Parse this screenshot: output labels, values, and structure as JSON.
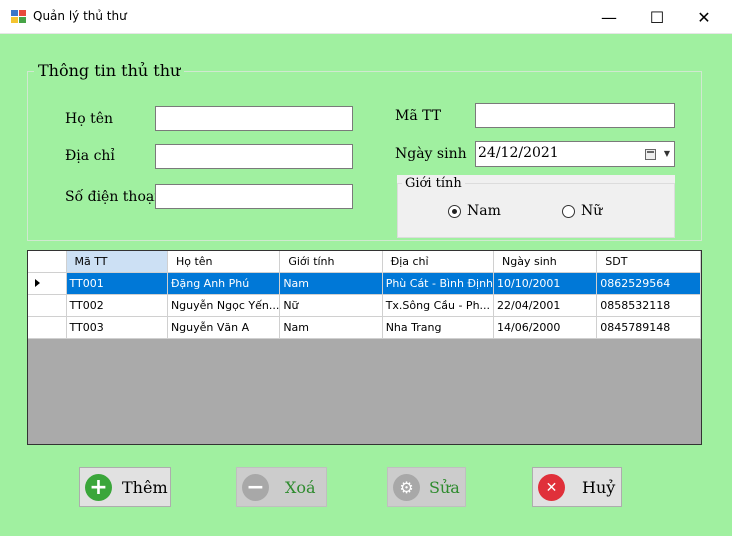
{
  "window": {
    "title": "Quản lý thủ thư",
    "minimize": "—",
    "maximize": "☐",
    "close": "✕"
  },
  "group": {
    "title": "Thông tin thủ thư"
  },
  "fields": {
    "ho_ten_label": "Họ tên",
    "ho_ten_value": "",
    "dia_chi_label": "Địa chỉ",
    "dia_chi_value": "",
    "sdt_label": "Số điện thoại",
    "sdt_value": "",
    "ma_tt_label": "Mã TT",
    "ma_tt_value": "",
    "ngay_sinh_label": "Ngày sinh",
    "ngay_sinh_value": "24/12/2021"
  },
  "gender": {
    "title": "Giới tính",
    "options": [
      "Nam",
      "Nữ"
    ],
    "selected": "Nam"
  },
  "grid": {
    "columns": [
      "Mã TT",
      "Họ tên",
      "Giới tính",
      "Địa chỉ",
      "Ngày sinh",
      "SDT"
    ],
    "rows": [
      [
        "TT001",
        "Đặng Anh Phú",
        "Nam",
        "Phù Cát - Bình Định",
        "10/10/2001",
        "0862529564"
      ],
      [
        "TT002",
        "Nguyễn Ngọc Yến...",
        "Nữ",
        "Tx.Sông Cầu - Ph...",
        "22/04/2001",
        "0858532118"
      ],
      [
        "TT003",
        "Nguyễn Văn A",
        "Nam",
        "Nha Trang",
        "14/06/2000",
        "0845789148"
      ]
    ],
    "selected_row": 0
  },
  "buttons": {
    "add": {
      "label": "Thêm",
      "icon": "plus-icon",
      "color": "#3aa63a"
    },
    "delete": {
      "label": "Xoá",
      "icon": "minus-icon",
      "color": "#9a9a9a"
    },
    "edit": {
      "label": "Sửa",
      "icon": "gear-icon",
      "color": "#9a9a9a"
    },
    "cancel": {
      "label": "Huỷ",
      "icon": "close-icon",
      "color": "#e0303a"
    }
  }
}
